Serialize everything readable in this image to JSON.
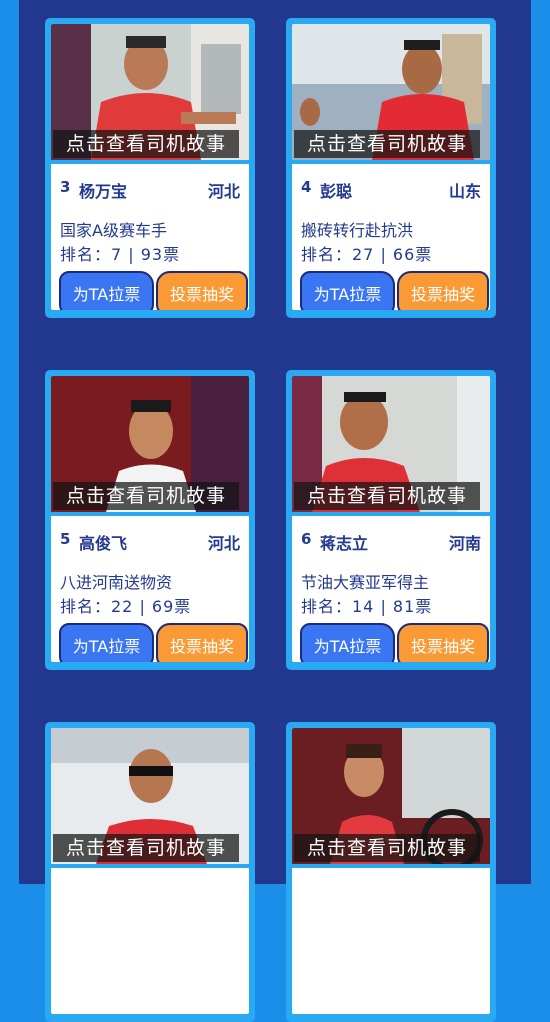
{
  "common": {
    "story_label": "点击查看司机故事",
    "vote_label": "为TA拉票",
    "lottery_label": "投票抽奖"
  },
  "cards": [
    {
      "rank": "3",
      "name": "杨万宝",
      "province": "河北",
      "slogan": "国家A级赛车手",
      "stat": "排名：7 | 93票"
    },
    {
      "rank": "4",
      "name": "彭聪",
      "province": "山东",
      "slogan": "搬砖转行赴抗洪",
      "stat": "排名：27 | 66票"
    },
    {
      "rank": "5",
      "name": "高俊飞",
      "province": "河北",
      "slogan": "八进河南送物资",
      "stat": "排名：22 | 69票"
    },
    {
      "rank": "6",
      "name": "蒋志立",
      "province": "河南",
      "slogan": "节油大赛亚军得主",
      "stat": "排名：14 | 81票"
    },
    {
      "rank": "",
      "name": "",
      "province": "",
      "slogan": "",
      "stat": ""
    },
    {
      "rank": "",
      "name": "",
      "province": "",
      "slogan": "",
      "stat": ""
    }
  ],
  "colors": {
    "background": "#1a8ee8",
    "panel": "#22388f",
    "card_border": "#28a9f1",
    "text": "#233a8e",
    "vote_button": "#3b76f2",
    "lottery_button": "#f99a34"
  }
}
